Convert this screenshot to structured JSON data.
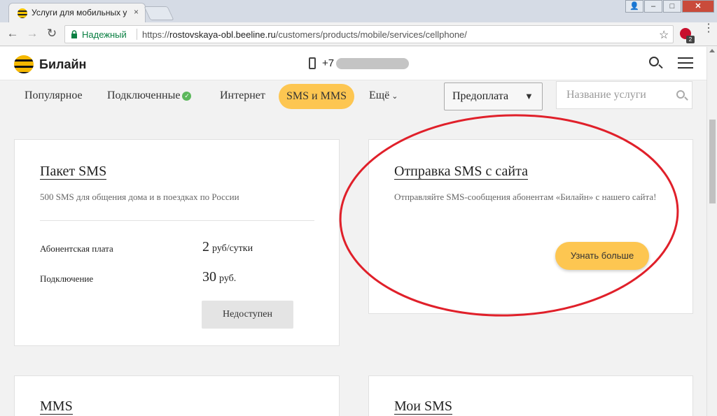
{
  "browser": {
    "tab_title": "Услуги для мобильных у",
    "tab_close": "×",
    "window_buttons": {
      "user": "👤",
      "minimize": "–",
      "maximize": "□",
      "close": "✕"
    },
    "secure_label": "Надежный",
    "url_scheme": "https://",
    "url_host": "rostovskaya-obl.beeline.ru",
    "url_path": "/customers/products/mobile/services/cellphone/",
    "extension_badge": "2"
  },
  "header": {
    "logo_text": "Билайн",
    "phone_prefix": "+7"
  },
  "subnav": {
    "items": [
      "Популярное",
      "Подключенные",
      "Интернет",
      "SMS и MMS",
      "Ещё"
    ],
    "plan_select_value": "Предоплата",
    "search_placeholder": "Название услуги"
  },
  "cards": [
    {
      "title": "Пакет SMS",
      "description": "500 SMS для общения дома и в поездках по России",
      "rows": [
        {
          "label": "Абонентская плата",
          "value": "2",
          "unit": "руб/сутки"
        },
        {
          "label": "Подключение",
          "value": "30",
          "unit": "руб."
        }
      ],
      "button": "Недоступен"
    },
    {
      "title": "Отправка SMS с сайта",
      "description": "Отправляйте SMS-сообщения абонентам «Билайн» с нашего сайта!",
      "button": "Узнать больше"
    },
    {
      "title": "MMS"
    },
    {
      "title": "Мои SMS"
    }
  ],
  "colors": {
    "brand_yellow": "#fdc651",
    "annotation_red": "#e0202a",
    "secure_green": "#0b8043"
  }
}
